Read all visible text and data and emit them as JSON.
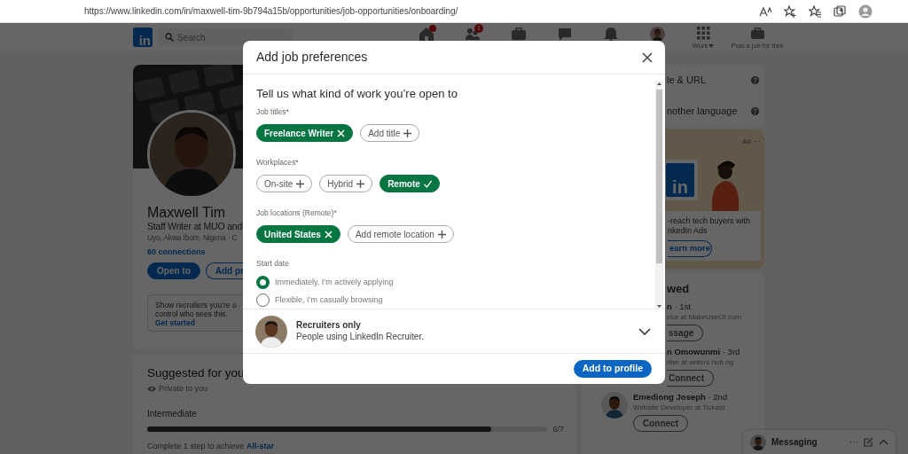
{
  "browser": {
    "url": "https://www.linkedin.com/in/maxwell-tim-9b794a15b/opportunities/job-opportunities/onboarding/"
  },
  "nav": {
    "logo": "in",
    "search": {
      "placeholder": "Search"
    },
    "network_badge": "1",
    "work": "Work",
    "post_job": "Post a job for free"
  },
  "profile": {
    "name": "Maxwell Tim",
    "headline": "Staff Writer at MUO and",
    "location": "Uyo, Akwa Ibom, Nigeria · C",
    "connections": "60 connections",
    "buttons": [
      "Open to",
      "Add pr"
    ],
    "recruiter_note": {
      "lines": [
        "Show recruiters you’re o",
        "control who sees this."
      ],
      "link": "Get started"
    }
  },
  "suggested": {
    "title": "Suggested for you",
    "privacy": "Private to you",
    "stage": "Intermediate",
    "progress": {
      "level": 0.86,
      "reading": "6/7"
    },
    "hint": "Complete 1 step to achieve",
    "hint_link": "All-star"
  },
  "sidebar": {
    "profile_links": [
      "le & URL",
      "nother language"
    ],
    "ad": {
      "label": "Ad",
      "more": "···",
      "logo": "in",
      "lines": [
        "-reach tech buyers with",
        "nkedIn Ads"
      ],
      "button": "earn more"
    },
    "people": {
      "title": "wed",
      "items": [
        {
          "name": "**n** · 1st",
          "headline": "ctor at MakeUseOf.com",
          "button": "ssage",
          "avatar": false
        },
        {
          "name": "**n Omowunmi** · 3rd",
          "headline": "riter at writers hub ng",
          "button": "Connect",
          "avatar": false
        },
        {
          "name": "**Emediong Joseph** · 2nd",
          "headline": "Website Developer at Tickast",
          "button": "Connect",
          "avatar": true
        }
      ]
    }
  },
  "messaging": {
    "title": "Messaging",
    "more": "···"
  },
  "modal": {
    "title": "Add job preferences",
    "heading": "Tell us what kind of work you’re open to",
    "sections": [
      {
        "label": "Job titles*",
        "chips": [
          {
            "label": "Freelance Writer",
            "kind": "tag",
            "selected": true
          },
          {
            "label": "Add title",
            "kind": "tag",
            "selected": false
          }
        ]
      },
      {
        "label": "Workplaces*",
        "chips": [
          {
            "label": "On-site",
            "kind": "toggle",
            "selected": false
          },
          {
            "label": "Hybrid",
            "kind": "toggle",
            "selected": false
          },
          {
            "label": "Remote",
            "kind": "toggle",
            "selected": true
          }
        ]
      },
      {
        "label": "Job locations (Remote)*",
        "chips": [
          {
            "label": "United States",
            "kind": "tag",
            "selected": true
          },
          {
            "label": "Add remote location",
            "kind": "tag",
            "selected": false
          }
        ]
      }
    ],
    "start_date": {
      "label": "Start date",
      "options": [
        {
          "label": "Immediately, I’m actively applying",
          "selected": true
        },
        {
          "label": "Flexible, I’m casually browsing",
          "selected": false
        }
      ]
    },
    "visibility": {
      "title": "Recruiters only",
      "description": "People using LinkedIn Recruiter."
    },
    "submit": "Add to profile"
  }
}
